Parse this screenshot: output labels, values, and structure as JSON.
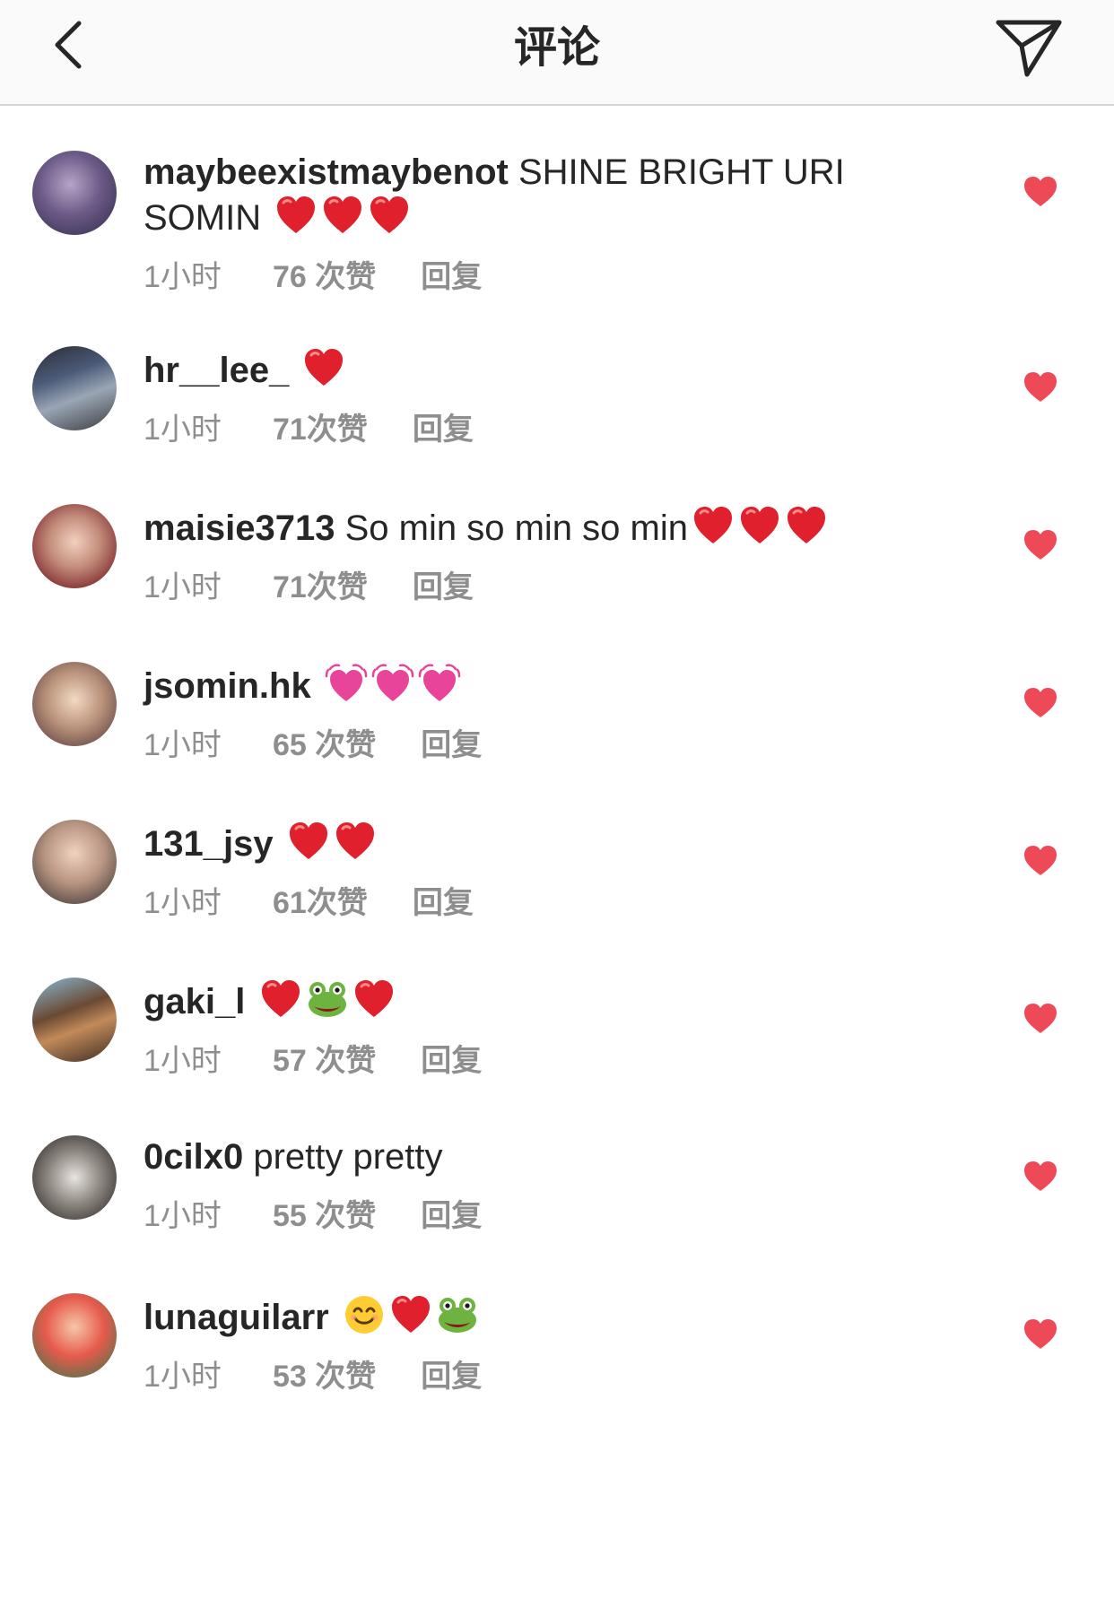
{
  "header": {
    "title": "评论",
    "back_icon": "chevron-left-icon",
    "send_icon": "paper-plane-icon"
  },
  "colors": {
    "heart_red": "#ed4956",
    "meta_gray": "#8e8e8e",
    "text": "#262626",
    "emoji_pink": "#e8459a",
    "frog_green": "#5aa63a"
  },
  "comments": [
    {
      "username": "maybeexistmaybenot",
      "text": " SHINE BRIGHT URI SOMIN ",
      "emojis": [
        "red-heart",
        "red-heart",
        "red-heart"
      ],
      "time": "1小时",
      "likes": "76 次赞",
      "reply": "回复"
    },
    {
      "username": "hr__lee_",
      "text": " ",
      "emojis": [
        "red-heart"
      ],
      "time": "1小时",
      "likes": "71次赞",
      "reply": "回复"
    },
    {
      "username": "maisie3713",
      "text": " So min so min so min",
      "emojis": [
        "red-heart",
        "red-heart",
        "red-heart"
      ],
      "time": "1小时",
      "likes": "71次赞",
      "reply": "回复"
    },
    {
      "username": "jsomin.hk",
      "text": " ",
      "emojis": [
        "pink-heart",
        "pink-heart",
        "pink-heart"
      ],
      "time": "1小时",
      "likes": "65 次赞",
      "reply": "回复"
    },
    {
      "username": "131_jsy",
      "text": " ",
      "emojis": [
        "red-heart",
        "red-heart"
      ],
      "time": "1小时",
      "likes": "61次赞",
      "reply": "回复"
    },
    {
      "username": "gaki_l",
      "text": " ",
      "emojis": [
        "red-heart",
        "frog",
        "red-heart"
      ],
      "time": "1小时",
      "likes": "57 次赞",
      "reply": "回复"
    },
    {
      "username": "0cilx0",
      "text": " pretty pretty",
      "emojis": [],
      "time": "1小时",
      "likes": "55 次赞",
      "reply": "回复"
    },
    {
      "username": "lunaguilarr",
      "text": " ",
      "emojis": [
        "smiley",
        "red-heart",
        "frog"
      ],
      "time": "1小时",
      "likes": "53 次赞",
      "reply": "回复"
    }
  ]
}
